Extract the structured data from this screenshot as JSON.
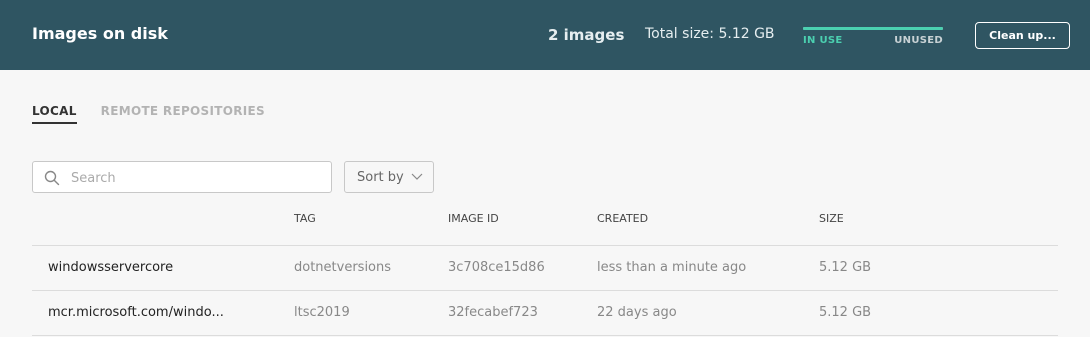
{
  "header": {
    "title": "Images on disk",
    "count": "2 images",
    "total_size": "Total size: 5.12 GB",
    "usage": {
      "in_use_label": "IN USE",
      "unused_label": "UNUSED",
      "in_use_fraction": 1.0,
      "in_use_color": "#4bd0b0"
    },
    "cleanup_label": "Clean up..."
  },
  "tabs": [
    {
      "label": "LOCAL",
      "active": true
    },
    {
      "label": "REMOTE REPOSITORIES",
      "active": false
    }
  ],
  "search": {
    "placeholder": "Search",
    "value": ""
  },
  "sort": {
    "label": "Sort by"
  },
  "table": {
    "columns": [
      "",
      "TAG",
      "IMAGE ID",
      "CREATED",
      "SIZE"
    ],
    "rows": [
      {
        "name": "windowsservercore",
        "tag": "dotnetversions",
        "image_id": "3c708ce15d86",
        "created": "less than a minute ago",
        "size": "5.12 GB"
      },
      {
        "name": "mcr.microsoft.com/windo...",
        "tag": "ltsc2019",
        "image_id": "32fecabef723",
        "created": "22 days ago",
        "size": "5.12 GB"
      }
    ]
  },
  "colors": {
    "header_bg": "#2f5562",
    "accent": "#4bd0b0"
  }
}
